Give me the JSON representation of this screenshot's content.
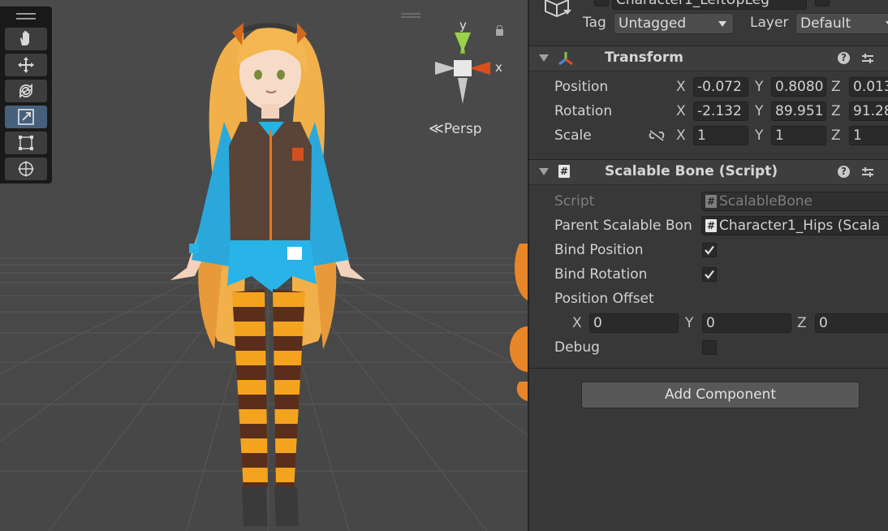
{
  "scene": {
    "view_label": "Persp",
    "gizmo": {
      "y_label": "y",
      "x_label": "x"
    },
    "tools": [
      "hand-tool",
      "move-tool",
      "rotate-tool",
      "scale-tool",
      "rect-tool",
      "transform-tool"
    ],
    "active_tool": "scale-tool"
  },
  "inspector": {
    "object_name": "Character1_LeftUpLeg",
    "tag_label": "Tag",
    "tag_value": "Untagged",
    "layer_label": "Layer",
    "layer_value": "Default",
    "transform": {
      "title": "Transform",
      "position": {
        "label": "Position",
        "x": "-0.072",
        "y": "0.8080",
        "z": "0.013"
      },
      "rotation": {
        "label": "Rotation",
        "x": "-2.132",
        "y": "89.951",
        "z": "91.28"
      },
      "scale": {
        "label": "Scale",
        "x": "1",
        "y": "1",
        "z": "1"
      },
      "axis_x": "X",
      "axis_y": "Y",
      "axis_z": "Z"
    },
    "script_component": {
      "title": "Scalable Bone (Script)",
      "script_label": "Script",
      "script_value": "ScalableBone",
      "parent_label": "Parent Scalable Bon",
      "parent_value": "Character1_Hips (Scala",
      "bind_position_label": "Bind Position",
      "bind_position": true,
      "bind_rotation_label": "Bind Rotation",
      "bind_rotation": true,
      "position_offset_label": "Position Offset",
      "offset": {
        "x": "0",
        "y": "0",
        "z": "0"
      },
      "debug_label": "Debug",
      "debug": false
    },
    "add_component_label": "Add Component",
    "help_icon_text": "?",
    "hash_text": "#"
  }
}
